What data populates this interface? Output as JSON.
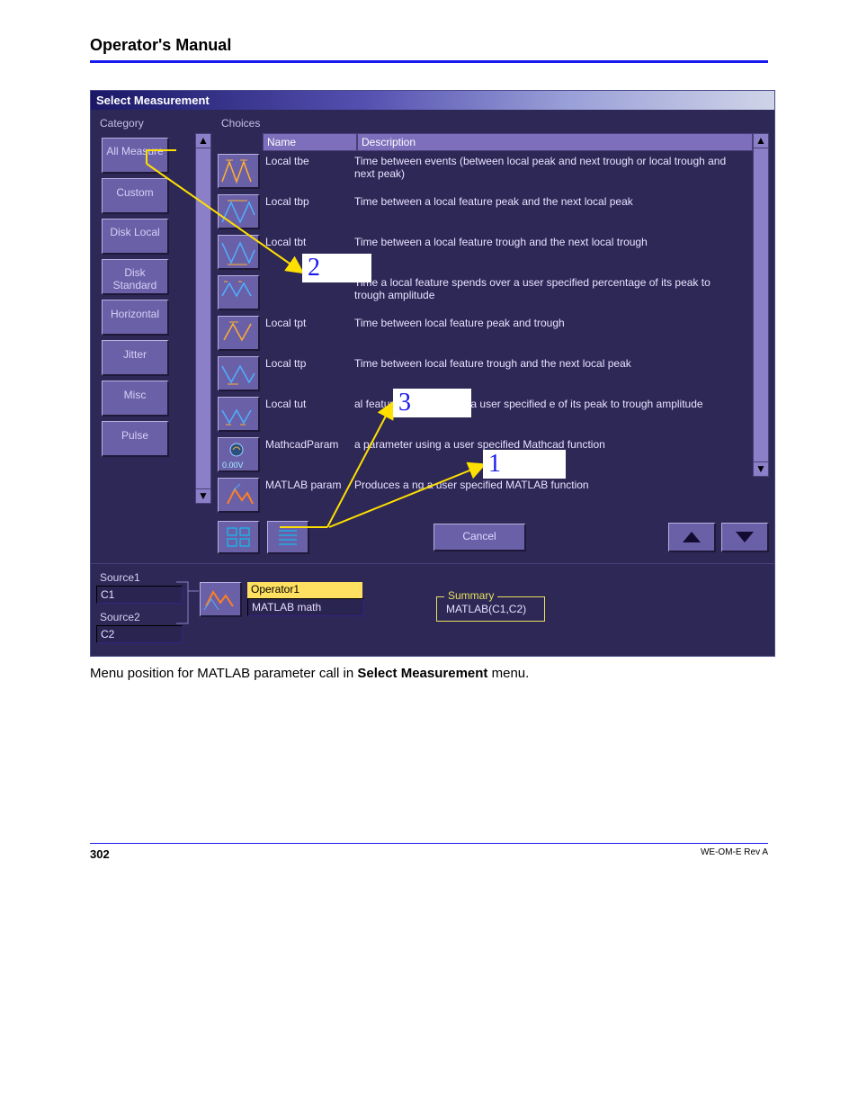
{
  "document": {
    "header": "Operator's Manual",
    "caption_pre": "Menu position for MATLAB parameter call in ",
    "caption_bold": "Select Measurement",
    "caption_post": " menu.",
    "page_number": "302",
    "revision": "WE-OM-E Rev A"
  },
  "window": {
    "title": "Select Measurement",
    "category_label": "Category",
    "choices_label": "Choices",
    "columns": {
      "name": "Name",
      "description": "Description"
    },
    "categories": [
      "All Measure",
      "Custom",
      "Disk Local",
      "Disk Standard",
      "Horizontal",
      "Jitter",
      "Misc",
      "Pulse"
    ],
    "rows": [
      {
        "name": "Local tbe",
        "desc": "Time between events (between local peak and next trough or local  trough and next peak)"
      },
      {
        "name": "Local tbp",
        "desc": "Time between a local feature peak and the next local peak"
      },
      {
        "name": "Local tbt",
        "desc": "Time between a local feature trough and the next local trough"
      },
      {
        "name": "",
        "desc": "Time a local feature spends over a user specified percentage of its peak to trough amplitude"
      },
      {
        "name": "Local tpt",
        "desc": "Time between local feature peak and trough"
      },
      {
        "name": "Local ttp",
        "desc": "Time between local feature trough and the next local peak"
      },
      {
        "name": "Local tut",
        "desc": "al feature spends under a user specified e of its peak to trough amplitude"
      },
      {
        "name": "MathcadParam",
        "desc": "a parameter using a user specified Mathcad function",
        "sub": "0.00V"
      },
      {
        "name": "MATLAB param",
        "desc": "Produces a                              ng a user specified MATLAB function"
      }
    ],
    "cancel": "Cancel",
    "sources": {
      "s1_label": "Source1",
      "s1_value": "C1",
      "s2_label": "Source2",
      "s2_value": "C2"
    },
    "operator": {
      "label": "Operator1",
      "value": "MATLAB math"
    },
    "summary": {
      "title": "Summary",
      "value": "MATLAB(C1,C2)"
    }
  },
  "annotations": {
    "n1": "1",
    "n2": "2",
    "n3": "3"
  }
}
